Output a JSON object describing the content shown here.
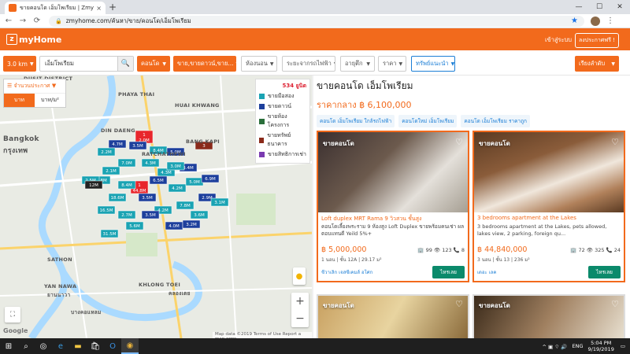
{
  "browser": {
    "tab_title": "ขายคอนโด เอ็มโพเรียม | ZmyHome",
    "url": "zmyhome.com/ค้นหา/ขาย/คอนโด/เอ็มโพเรียม",
    "tab_close": "×",
    "new_tab": "+",
    "back": "←",
    "forward": "→",
    "reload": "⟳",
    "lock": "🔒",
    "star": "★",
    "menu": "⋮",
    "win_min": "—",
    "win_max": "☐",
    "win_close": "✕"
  },
  "site": {
    "logo": "myHome",
    "logo_mark": "z",
    "login": "เข้าสู่ระบบ",
    "post_button": "ลงประกาศฟรี !"
  },
  "filters": {
    "radius": "3.0 km",
    "search_value": "เอ็มโพเรียม",
    "search_icon": "🔍",
    "property_type": "คอนโด",
    "sale_type": "ขาย,ขายดาวน์,ขาย...",
    "rooms": "ห้องนอน",
    "bts": "ระยะจากรถไฟฟ้า",
    "age": "อายุตึก",
    "price": "ราคา",
    "recommend": "ทรัพย์แนะนำ",
    "sort": "เรียงลำดับ",
    "caret": "▼"
  },
  "map": {
    "toggle_header": "☰ จำนวนประกาศ ▼",
    "unit_a": "บาท",
    "unit_b": "บาท/ม²",
    "count": "534 ยูนิต",
    "legend": [
      {
        "label": "ขายมือสอง",
        "color": "#1aa3b3"
      },
      {
        "label": "ขายดาวน์",
        "color": "#1d3f9c"
      },
      {
        "label": "ขายห้องโครงการ",
        "color": "#2a6e3a"
      },
      {
        "label": "ขายทรัพย์ธนาคาร",
        "color": "#8a2a1a"
      },
      {
        "label": "ขายสิทธิการเช่า",
        "color": "#7a3ab0"
      }
    ],
    "labels": [
      "DUSIT DISTRICT",
      "DIN DAENG",
      "HUAI KHWANG",
      "PHAYA THAI",
      "KHLONG TOEI",
      "SATHON",
      "YAN NAWA",
      "BANG KAPI",
      "RATCHATHEWI",
      "Bangkok",
      "กรุงเทพ",
      "คลองเตย",
      "ยานนาวา",
      "บางคอแหลม"
    ],
    "footer": "Map data ©2019   Terms of Use   Report a map error",
    "google": "Google",
    "pins": [
      {
        "label": "1",
        "sub": "2.0M",
        "color": "#e8262c"
      },
      {
        "label": "4.7M",
        "color": "#1d3f9c"
      },
      {
        "label": "2.2M",
        "color": "#1aa3b3"
      },
      {
        "label": "3.5M",
        "color": "#1d3f9c"
      },
      {
        "label": "8.4M",
        "color": "#1aa3b3"
      },
      {
        "label": "5.0M",
        "color": "#1d3f9c"
      },
      {
        "label": "4.3M",
        "color": "#1aa3b3"
      },
      {
        "label": "7.0M",
        "color": "#1aa3b3"
      },
      {
        "label": "2.1M",
        "color": "#1aa3b3"
      },
      {
        "label": "1",
        "sub": "44.8M",
        "color": "#e8262c"
      },
      {
        "label": "4.3M",
        "color": "#1aa3b3"
      },
      {
        "label": "3.4M",
        "color": "#1d3f9c"
      },
      {
        "label": "2.8M",
        "color": "#1aa3b3"
      },
      {
        "label": "18.6M",
        "color": "#1aa3b3"
      },
      {
        "label": "3.5M",
        "color": "#1d3f9c"
      },
      {
        "label": "4.2M",
        "color": "#1aa3b3"
      },
      {
        "label": "5.0M",
        "color": "#1aa3b3"
      },
      {
        "label": "6.9M",
        "color": "#1d3f9c"
      },
      {
        "label": "4.2M",
        "color": "#1aa3b3"
      },
      {
        "label": "7.8M",
        "color": "#1aa3b3"
      },
      {
        "label": "2.9M",
        "color": "#1d3f9c"
      },
      {
        "label": "3.1M",
        "color": "#1aa3b3"
      },
      {
        "label": "4.0M",
        "color": "#1d3f9c"
      },
      {
        "label": "2.7M",
        "color": "#1aa3b3"
      },
      {
        "label": "31.5M",
        "color": "#1aa3b3"
      },
      {
        "label": "5.6M",
        "color": "#1aa3b3"
      },
      {
        "label": "3.2M",
        "color": "#1d3f9c"
      },
      {
        "label": "16.5M",
        "color": "#1aa3b3"
      },
      {
        "label": "2.5M",
        "color": "#1aa3b3"
      },
      {
        "label": "6.5M",
        "color": "#1d3f9c"
      },
      {
        "label": "3.6M",
        "color": "#1aa3b3"
      },
      {
        "label": "3",
        "color": "#8a2a1a"
      },
      {
        "label": "12M",
        "color": "#222"
      },
      {
        "label": "8.4M",
        "color": "#1aa3b3"
      },
      {
        "label": "3.5M",
        "color": "#1d3f9c"
      },
      {
        "label": "3.0M",
        "color": "#1aa3b3"
      }
    ]
  },
  "results": {
    "title": "ขายคอนโด เอ็มโพเรียม",
    "avg_price": "ราคากลาง ฿ 6,100,000",
    "tags": [
      "คอนโด เอ็มโพเรียม ใกล้รถไฟฟ้า",
      "คอนโดใหม่ เอ็มโพเรียม",
      "คอนโด เอ็มโพเรียม ราคาถูก"
    ],
    "cards": [
      {
        "badge": "ขายคอนโด",
        "title": "Loft duplex MRT Rama 9 วิวสวน ชั้นสูง",
        "desc": "คอนโดเลี้ยงพระราม 9 ห้องสูง Loft Duplex ขายพร้อมคนเช่า ผลตอบแทนดี Yeild 5%+",
        "price": "฿ 5,000,000",
        "stats": "🏢 99  👁 123  📞 8",
        "meta": "1 นอน | ชั้น 12A | 29.17 ม²",
        "agent": "ชีวาเลิก เจสซีเคมส์ อโศก",
        "button": "ไหรเลย"
      },
      {
        "badge": "ขายคอนโด",
        "title": "3 bedrooms apartment at the Lakes",
        "desc": "3 bedrooms apartment at the Lakes, pets allowed, lakes view, 2 parking, foreign qu...",
        "price": "฿ 44,840,000",
        "stats": "🏢 72  👁 325  📞 24",
        "meta": "3 นอน | ชั้น 13 | 236 ม²",
        "agent": "เดอะ เลค",
        "button": "ไหรเลย"
      }
    ],
    "card_row2": [
      {
        "badge": "ขายคอนโด"
      },
      {
        "badge": "ขายคอนโด"
      }
    ],
    "heart": "♡"
  },
  "taskbar": {
    "start": "⊞",
    "search": "⌕",
    "task": "◎",
    "edge": "e",
    "folder": "▬",
    "store": "🛍",
    "outlook": "O",
    "chrome": "◉",
    "tray_icons": "^  ▣  ⌔  🔊",
    "lang": "ENG",
    "time": "5:04 PM",
    "date": "9/19/2019"
  }
}
